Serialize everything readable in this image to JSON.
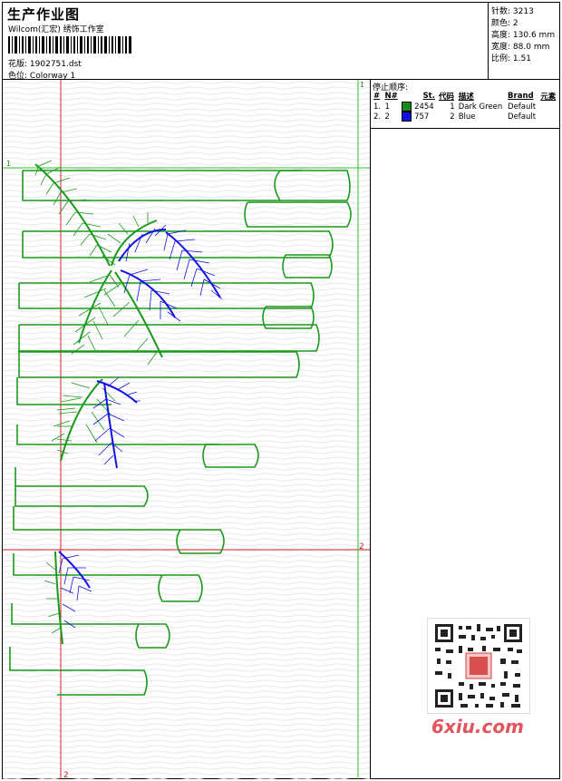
{
  "header": {
    "title": "生产作业图",
    "company": "Wilcom(汇宏) 绣饰工作室",
    "design_label": "花版:",
    "design_value": "1902751.dst",
    "colorway_label": "色位:",
    "colorway_value": "Colorway 1"
  },
  "stats": [
    {
      "label": "针数:",
      "value": "3213"
    },
    {
      "label": "颜色:",
      "value": "2"
    },
    {
      "label": "高度:",
      "value": "130.6 mm"
    },
    {
      "label": "宽度:",
      "value": "88.0 mm"
    },
    {
      "label": "比例:",
      "value": "1.51"
    }
  ],
  "stop_sequence": {
    "title": "停止顺序:",
    "columns": [
      "#",
      "N#",
      "St.",
      "代码",
      "描述",
      "Brand",
      "元素"
    ],
    "rows": [
      {
        "idx": "1.",
        "n": "1",
        "stitches": "2454",
        "code": "1",
        "desc": "Dark Green",
        "brand": "Default",
        "color": "#1a8a1a"
      },
      {
        "idx": "2.",
        "n": "2",
        "stitches": "757",
        "code": "2",
        "desc": "Blue",
        "brand": "Default",
        "color": "#1010e0"
      }
    ]
  },
  "markers": {
    "top_1": "1",
    "left_1": "1",
    "right_2": "2",
    "bottom_2": "2"
  },
  "watermark": {
    "text": "6xiu.com"
  }
}
